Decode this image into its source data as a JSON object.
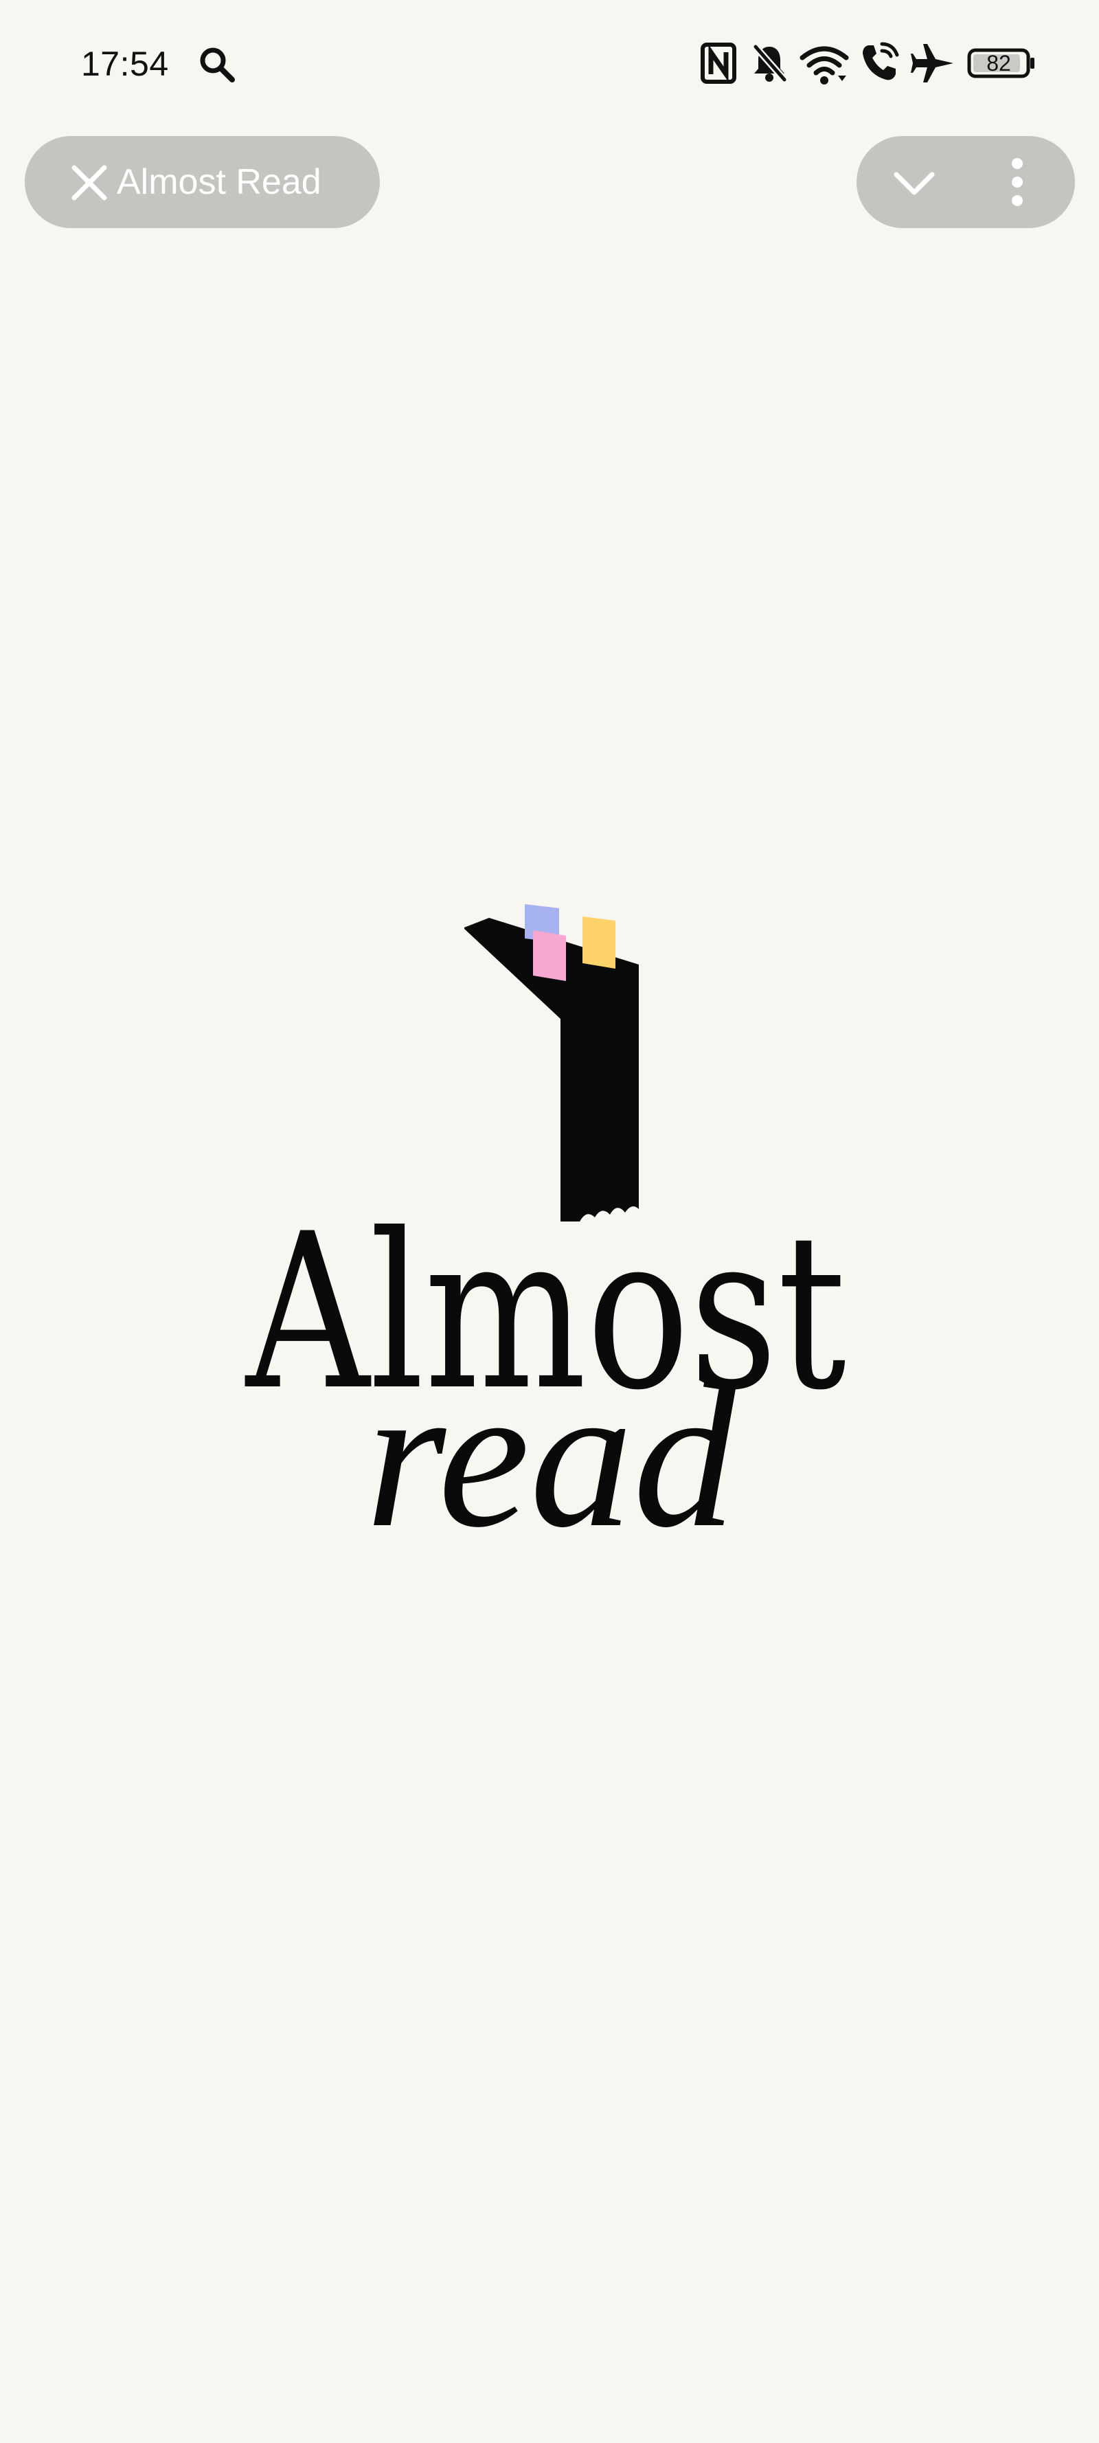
{
  "colors": {
    "background": "#F8F6F0",
    "text": "#111111",
    "pill_bg": "#C4C4C1",
    "pill_fg": "#FFFFFF",
    "logo_black": "#0A0A0A",
    "logo_blue": "#A6B3F0",
    "logo_pink": "#F6A8D2",
    "logo_yellow": "#FFD36B"
  },
  "status_bar": {
    "time": "17:54",
    "battery_percent": "82",
    "icons": [
      "search-icon",
      "nfc-icon",
      "bell-off-icon",
      "wifi-icon",
      "wifi-calling-icon",
      "airplane-icon",
      "battery-icon"
    ]
  },
  "top_bar": {
    "close_icon": "close-icon",
    "title": "Almost Read",
    "collapse_icon": "chevron-down-icon",
    "menu_icon": "more-vertical-icon"
  },
  "logo": {
    "line1": "Almost",
    "line2": "read"
  }
}
